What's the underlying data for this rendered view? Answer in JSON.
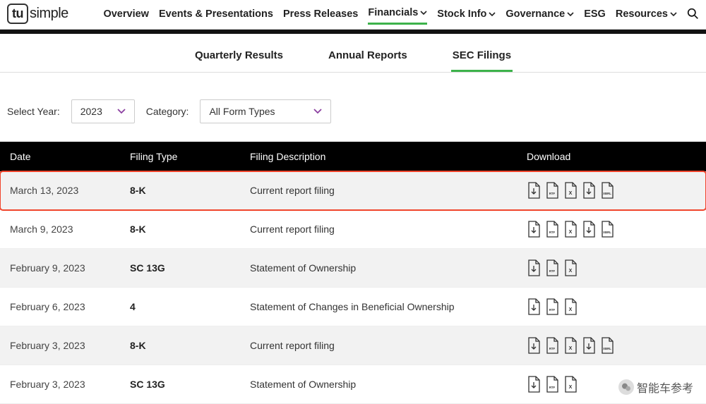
{
  "logo": {
    "box": "tu",
    "rest": "simple"
  },
  "nav": {
    "items": [
      {
        "label": "Overview",
        "chev": false
      },
      {
        "label": "Events & Presentations",
        "chev": false
      },
      {
        "label": "Press Releases",
        "chev": false
      },
      {
        "label": "Financials",
        "chev": true,
        "active": true
      },
      {
        "label": "Stock Info",
        "chev": true
      },
      {
        "label": "Governance",
        "chev": true
      },
      {
        "label": "ESG",
        "chev": false
      },
      {
        "label": "Resources",
        "chev": true
      }
    ]
  },
  "subtabs": [
    {
      "label": "Quarterly Results"
    },
    {
      "label": "Annual Reports"
    },
    {
      "label": "SEC Filings",
      "active": true
    }
  ],
  "filters": {
    "year_label": "Select Year:",
    "year_value": "2023",
    "category_label": "Category:",
    "category_value": "All Form Types"
  },
  "table": {
    "headers": {
      "date": "Date",
      "type": "Filing Type",
      "desc": "Filing Description",
      "download": "Download"
    },
    "rows": [
      {
        "date": "March 13, 2023",
        "type": "8-K",
        "desc": "Current report filing",
        "dl": [
          "pdf",
          "rtf",
          "x",
          "doc",
          "xbrl"
        ],
        "highlighted": true,
        "odd": true
      },
      {
        "date": "March 9, 2023",
        "type": "8-K",
        "desc": "Current report filing",
        "dl": [
          "pdf",
          "rtf",
          "x",
          "doc",
          "xbrl"
        ]
      },
      {
        "date": "February 9, 2023",
        "type": "SC 13G",
        "desc": "Statement of Ownership",
        "dl": [
          "pdf",
          "rtf",
          "x"
        ],
        "odd": true
      },
      {
        "date": "February 6, 2023",
        "type": "4",
        "desc": "Statement of Changes in Beneficial Ownership",
        "dl": [
          "pdf",
          "rtf",
          "x"
        ]
      },
      {
        "date": "February 3, 2023",
        "type": "8-K",
        "desc": "Current report filing",
        "dl": [
          "pdf",
          "rtf",
          "x",
          "doc",
          "xbrl"
        ],
        "odd": true
      },
      {
        "date": "February 3, 2023",
        "type": "SC 13G",
        "desc": "Statement of Ownership",
        "dl": [
          "pdf",
          "rtf",
          "x"
        ]
      }
    ]
  },
  "watermark": "智能车参考"
}
